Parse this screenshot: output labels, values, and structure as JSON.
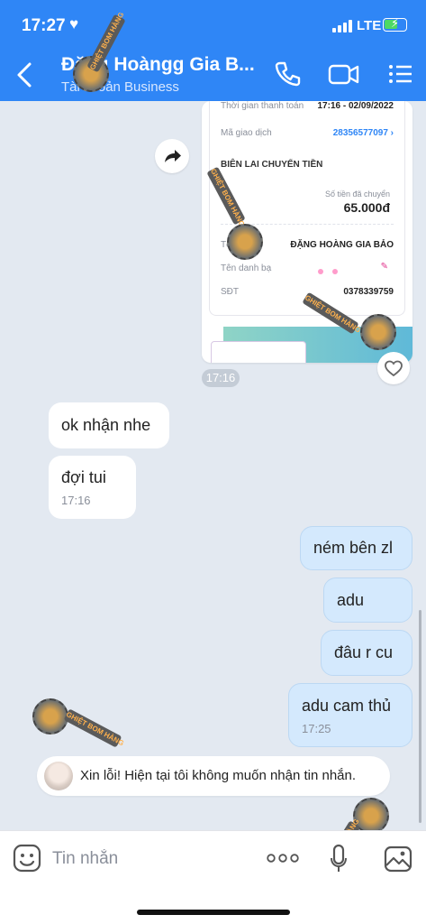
{
  "status_bar": {
    "time": "17:27",
    "network": "LTE"
  },
  "header": {
    "title": "Đặng Hoàngg Gia B...",
    "subtitle": "Tài khoản Business"
  },
  "receipt": {
    "rows": [
      {
        "label": "Thời gian thanh toán",
        "value": "17:16 - 02/09/2022"
      },
      {
        "label": "Mã giao dịch",
        "value": "28356577097 ›"
      }
    ],
    "section_title": "BIÊN LAI CHUYỂN TIỀN",
    "amount_label": "Số tiền đã chuyển",
    "amount": "65.000đ",
    "recipient_label": "Tên TK",
    "recipient_value": "ĐẶNG HOÀNG GIA BẢO",
    "contact_label": "Tên danh bạ",
    "phone_label": "SĐT",
    "phone_value": "0378339759"
  },
  "receipt_time": "17:16",
  "messages": [
    {
      "side": "in",
      "text": "ok nhận nhe"
    },
    {
      "side": "in",
      "text": "đợi tui",
      "time": "17:16"
    },
    {
      "side": "out",
      "text": "ném bên zl"
    },
    {
      "side": "out",
      "text": "adu"
    },
    {
      "side": "out",
      "text": "đâu r cu"
    },
    {
      "side": "out",
      "text": "adu cam thủ",
      "time": "17:25"
    }
  ],
  "notice": {
    "text": "Xin lỗi! Hiện tại tôi không muốn nhận tin nhắn."
  },
  "composer": {
    "placeholder": "Tin nhắn"
  },
  "watermark": {
    "text": "GHIỆT BOM HÀNG"
  },
  "colors": {
    "header": "#2f86f6",
    "outgoing_bubble": "#d4e9fd",
    "background": "#e3e9f1"
  }
}
